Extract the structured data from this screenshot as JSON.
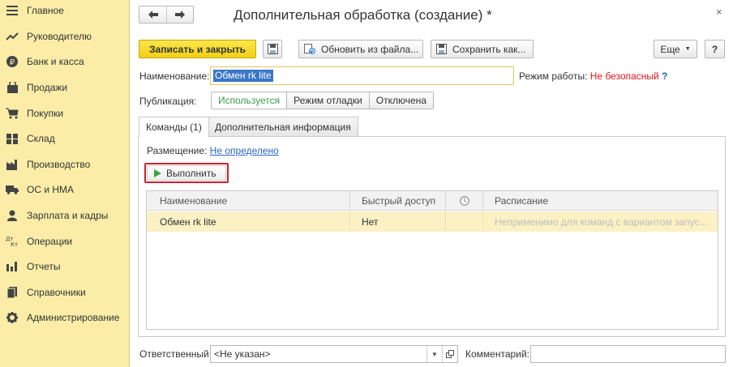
{
  "sidebar": {
    "items": [
      {
        "label": "Главное",
        "icon": "menu-lines-icon"
      },
      {
        "label": "Руководителю",
        "icon": "trend-line-icon"
      },
      {
        "label": "Банк и касса",
        "icon": "ruble-coin-icon"
      },
      {
        "label": "Продажи",
        "icon": "shopping-bag-icon"
      },
      {
        "label": "Покупки",
        "icon": "shopping-cart-icon"
      },
      {
        "label": "Склад",
        "icon": "warehouse-grid-icon"
      },
      {
        "label": "Производство",
        "icon": "factory-icon"
      },
      {
        "label": "ОС и НМА",
        "icon": "truck-icon"
      },
      {
        "label": "Зарплата и кадры",
        "icon": "person-icon"
      },
      {
        "label": "Операции",
        "icon": "dt-kt-icon"
      },
      {
        "label": "Отчеты",
        "icon": "bar-chart-icon"
      },
      {
        "label": "Справочники",
        "icon": "book-icon"
      },
      {
        "label": "Администрирование",
        "icon": "gear-icon"
      }
    ]
  },
  "header": {
    "title": "Дополнительная обработка (создание) *",
    "close": "×"
  },
  "toolbar": {
    "save_close_label": "Записать и закрыть",
    "update_from_file_label": "Обновить из файла...",
    "save_as_label": "Сохранить как...",
    "more_label": "Еще",
    "help_label": "?"
  },
  "form": {
    "name_label": "Наименование:",
    "name_value": "Обмен rk lite",
    "mode_label": "Режим работы:",
    "mode_value": "Не безопасный",
    "mode_help": "?",
    "publication_label": "Публикация:",
    "publication_options": [
      "Используется",
      "Режим отладки",
      "Отключена"
    ]
  },
  "tabs": [
    {
      "label": "Команды (1)"
    },
    {
      "label": "Дополнительная информация"
    }
  ],
  "commands": {
    "placement_label": "Размещение:",
    "placement_value": "Не определено",
    "run_label": "Выполнить",
    "columns": [
      "Наименование",
      "Быстрый доступ",
      "",
      "Расписание"
    ],
    "rows": [
      {
        "name": "Обмен rk lite",
        "quick_access": "Нет",
        "schedule": "Неприменимо для команд с вариантом запус..."
      }
    ]
  },
  "footer": {
    "responsible_label": "Ответственный:",
    "responsible_value": "<Не указан>",
    "comment_label": "Комментарий:",
    "comment_value": ""
  },
  "colors": {
    "sidebar_bg": "#fbeda7",
    "primary_button": "#f2cf14",
    "selection": "#3a77c8",
    "danger": "#e0161c",
    "link": "#2a65c2",
    "active_option": "#3a9b4a",
    "row_highlight": "#fbf1c4"
  }
}
